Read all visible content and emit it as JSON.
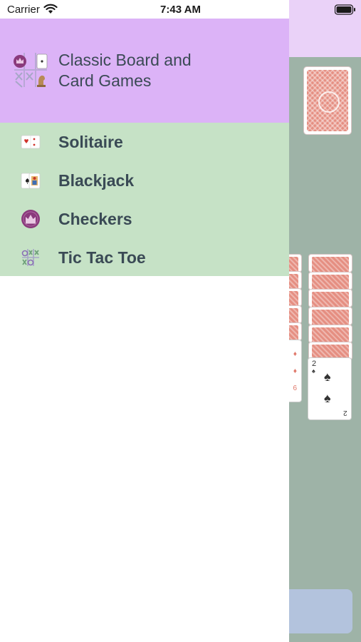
{
  "status_bar": {
    "carrier": "Carrier",
    "time": "7:43 AM"
  },
  "drawer": {
    "header": {
      "title_line1": "Classic Board and",
      "title_line2": "Card Games",
      "logo_icon": "board-games-logo-icon"
    },
    "items": [
      {
        "label": "Solitaire",
        "icon": "solitaire-cards-icon"
      },
      {
        "label": "Blackjack",
        "icon": "blackjack-cards-icon"
      },
      {
        "label": "Checkers",
        "icon": "checkers-king-icon"
      },
      {
        "label": "Tic Tac Toe",
        "icon": "tic-tac-toe-icon"
      }
    ]
  },
  "background_game": {
    "visible_card": {
      "rank": "2",
      "suit": "spades"
    },
    "partial_card_rank": "6"
  },
  "colors": {
    "header_bg": "#dcb3f7",
    "menu_bg": "#c6e2c6",
    "table_bg": "#9eb3a7",
    "card_back": "#e58f82",
    "text": "#3a4a55"
  }
}
